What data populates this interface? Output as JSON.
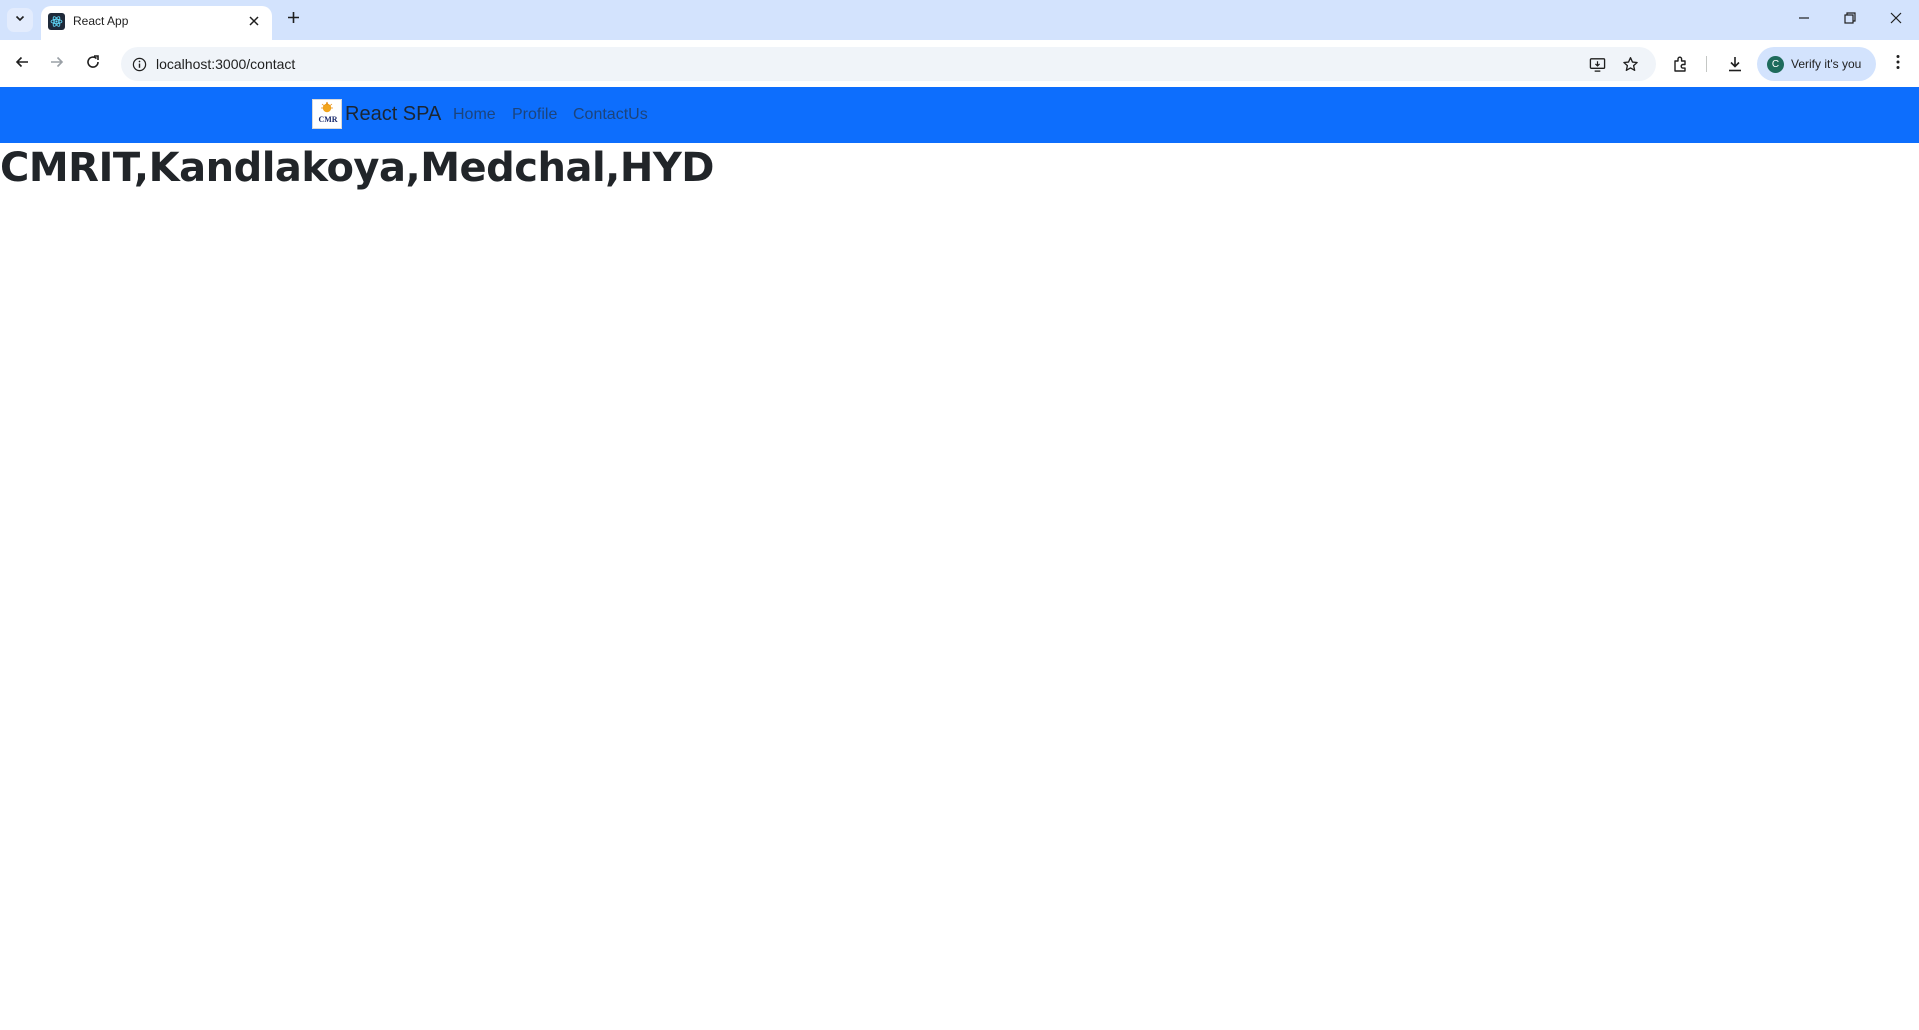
{
  "browser": {
    "tab": {
      "title": "React App"
    },
    "address_bar": {
      "url": "localhost:3000/contact"
    },
    "profile_chip": {
      "label": "Verify it's you",
      "avatar_letter": "C"
    }
  },
  "page": {
    "navbar": {
      "brand_name": "React SPA",
      "logo_text": "CMR",
      "links": [
        "Home",
        "Profile",
        "ContactUs"
      ],
      "background_color": "#0d6efd"
    },
    "heading": "CMRIT,Kandlakoya,Medchal,HYD"
  }
}
